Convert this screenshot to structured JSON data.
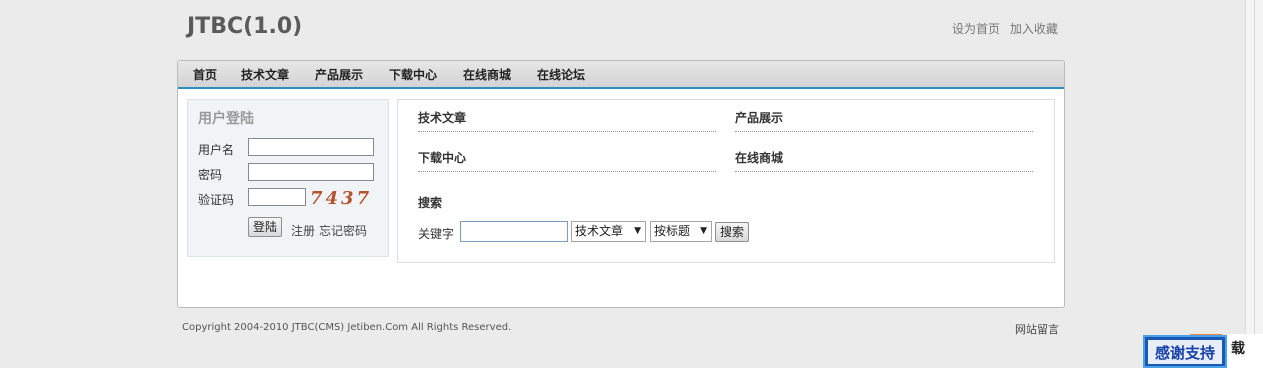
{
  "site": {
    "title": "JTBC(1.0)"
  },
  "top_links": [
    "设为首页",
    "加入收藏"
  ],
  "nav": [
    "首页",
    "技术文章",
    "产品展示",
    "下载中心",
    "在线商城",
    "在线论坛"
  ],
  "login": {
    "title": "用户登陆",
    "username_label": "用户名",
    "password_label": "密码",
    "captcha_label": "验证码",
    "captcha_value": "7437",
    "login_button": "登陆",
    "register_link": "注册",
    "forgot_link": "忘记密码"
  },
  "sections": {
    "articles": "技术文章",
    "products": "产品展示",
    "downloads": "下载中心",
    "shop": "在线商城"
  },
  "search": {
    "title": "搜索",
    "keyword_label": "关键字",
    "category_selected": "技术文章",
    "field_selected": "按标题",
    "button": "搜索"
  },
  "footer": {
    "copyright": "Copyright 2004-2010 JTBC(CMS) Jetiben.Com All Rights Reserved.",
    "guestbook": "网站留言"
  },
  "badge": {
    "label": "感谢支持",
    "extra": "载"
  },
  "icons": {
    "dropdown": "chevron-down-icon"
  }
}
